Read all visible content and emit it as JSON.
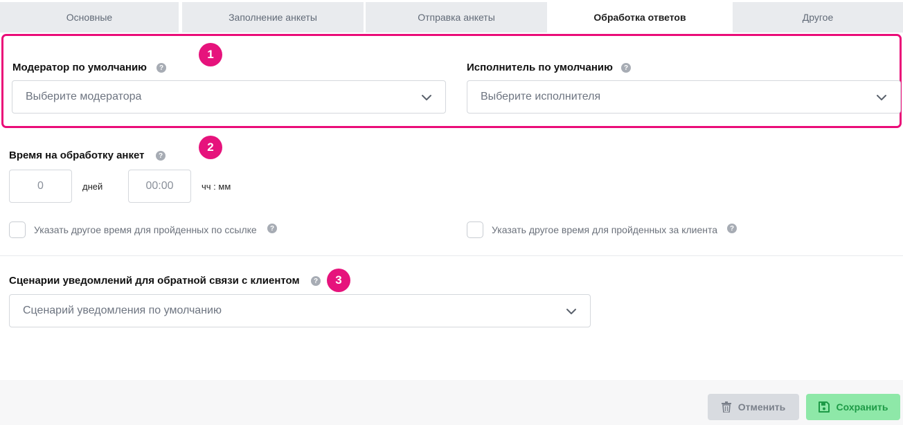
{
  "tabs": [
    {
      "label": "Основные",
      "active": false
    },
    {
      "label": "Заполнение анкеты",
      "active": false
    },
    {
      "label": "Отправка анкеты",
      "active": false
    },
    {
      "label": "Обработка ответов",
      "active": true
    },
    {
      "label": "Другое",
      "active": false
    }
  ],
  "badges": [
    "1",
    "2",
    "3"
  ],
  "moderator": {
    "label": "Модератор по умолчанию",
    "placeholder": "Выберите модератора"
  },
  "executor": {
    "label": "Исполнитель по умолчанию",
    "placeholder": "Выберите исполнителя"
  },
  "processing_time": {
    "label": "Время на обработку анкет",
    "days_value": "0",
    "days_unit": "дней",
    "time_value": "00:00",
    "time_unit": "чч : мм"
  },
  "checkboxes": {
    "by_link": {
      "label": "Указать другое время для пройденных по ссылке",
      "checked": false
    },
    "for_client": {
      "label": "Указать другое время для пройденных за клиента",
      "checked": false
    }
  },
  "notifications": {
    "label": "Сценарии уведомлений для обратной связи с клиентом",
    "value": "Сценарий уведомления по умолчанию"
  },
  "footer": {
    "cancel_label": "Отменить",
    "save_label": "Сохранить"
  },
  "colors": {
    "accent": "#e6137c",
    "save_bg": "#8ee8a8",
    "save_text": "#1d9a46",
    "cancel_bg": "#d8dbe0"
  },
  "icons": [
    "help-icon",
    "chevron-down-icon",
    "trash-icon",
    "save-icon"
  ]
}
